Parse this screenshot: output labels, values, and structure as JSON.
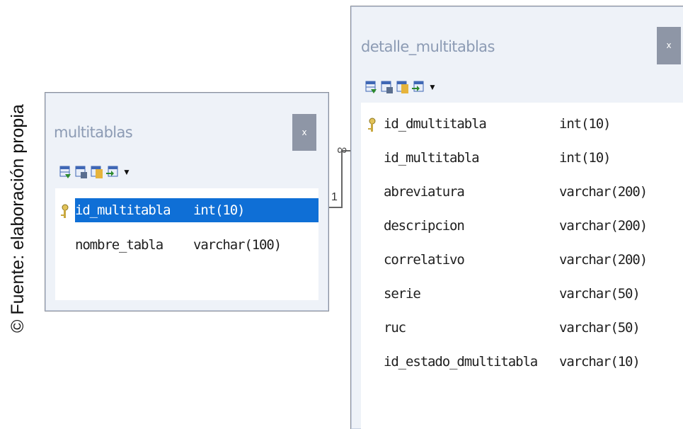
{
  "caption": "© Fuente: elaboración propia",
  "relation": {
    "one": "1",
    "many": "∞"
  },
  "tables": {
    "multitablas": {
      "title": "multitablas",
      "close": "x",
      "columns": [
        {
          "name": "id_multitabla",
          "type": "int(10)",
          "primary_key": true,
          "selected": true
        },
        {
          "name": "nombre_tabla",
          "type": "varchar(100)"
        }
      ]
    },
    "detalle": {
      "title": "detalle_multitablas",
      "close": "x",
      "columns": [
        {
          "name": "id_dmultitabla",
          "type": "int(10)",
          "primary_key": true
        },
        {
          "name": "id_multitabla",
          "type": "int(10)"
        },
        {
          "name": "abreviatura",
          "type": "varchar(200)"
        },
        {
          "name": "descripcion",
          "type": "varchar(200)"
        },
        {
          "name": "correlativo",
          "type": "varchar(200)"
        },
        {
          "name": "serie",
          "type": "varchar(50)"
        },
        {
          "name": "ruc",
          "type": "varchar(50)"
        },
        {
          "name": "id_estado_dmultitabla",
          "type": "varchar(10)"
        }
      ]
    }
  },
  "toolbar_icons": [
    "add-column-icon",
    "indexes-icon",
    "keys-icon",
    "relations-icon"
  ],
  "colors": {
    "selection": "#0f6fd6",
    "title": "#8c9bb4",
    "window_bg": "#eef2f8",
    "close_bg": "#8e96a6"
  }
}
